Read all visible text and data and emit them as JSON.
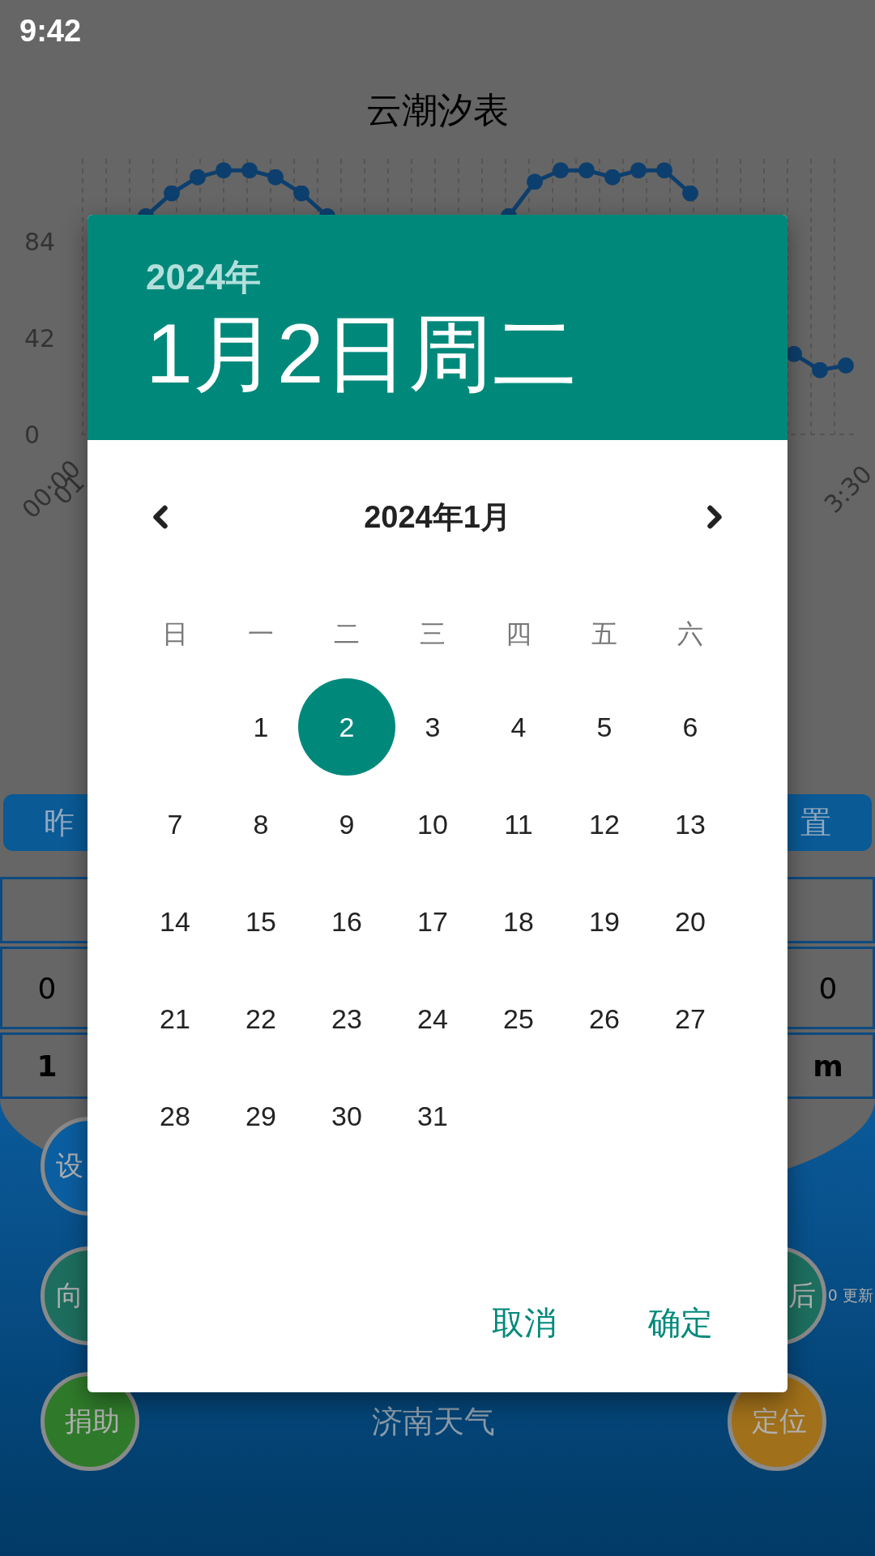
{
  "status_bar": {
    "time": "9:42"
  },
  "app": {
    "title": "云潮汐表",
    "chart": {
      "x_labels": [
        "00:00",
        "01",
        "3:30"
      ],
      "chart_data": {
        "type": "line",
        "ylim": [
          0,
          120
        ],
        "yticks": [
          84,
          42,
          0
        ],
        "grid": true,
        "series": [
          {
            "color": "#0d3f6e",
            "values": [
              null,
              null,
              95,
              105,
              112,
              115,
              115,
              112,
              105,
              95,
              null,
              null,
              null,
              null,
              null,
              null,
              95,
              110,
              115,
              115,
              112,
              115,
              115,
              105,
              null,
              null,
              null,
              35,
              28,
              30
            ]
          }
        ]
      }
    },
    "buttons": [
      "昨",
      "置"
    ],
    "table": {
      "rows": [
        [],
        [
          "0",
          "0"
        ],
        [
          "1",
          "m"
        ]
      ]
    },
    "circle_rows": [
      [
        {
          "label": "设",
          "color": "#0b5ea0"
        }
      ],
      [
        {
          "label": "向",
          "color": "#1d6e5e"
        },
        {
          "label": "后",
          "color": "#1d6e5e"
        }
      ],
      [
        {
          "label": "捐助",
          "color": "#2f7a2a"
        },
        {
          "label": "定位",
          "color": "#a0701a"
        }
      ]
    ],
    "update_note": "0 更新",
    "city": "济南天气"
  },
  "dialog": {
    "year": "2024年",
    "date": "1月2日周二",
    "month": "2024年1月",
    "weekdays": [
      "日",
      "一",
      "二",
      "三",
      "四",
      "五",
      "六"
    ],
    "weeks": [
      [
        {
          "kind": "empty"
        },
        {
          "kind": "day",
          "label": "1",
          "selected": false
        },
        {
          "kind": "day",
          "label": "2",
          "selected": true
        },
        {
          "kind": "day",
          "label": "3",
          "selected": false
        },
        {
          "kind": "day",
          "label": "4",
          "selected": false
        },
        {
          "kind": "day",
          "label": "5",
          "selected": false
        },
        {
          "kind": "day",
          "label": "6",
          "selected": false
        }
      ],
      [
        {
          "kind": "day",
          "label": "7",
          "selected": false
        },
        {
          "kind": "day",
          "label": "8",
          "selected": false
        },
        {
          "kind": "day",
          "label": "9",
          "selected": false
        },
        {
          "kind": "day",
          "label": "10",
          "selected": false
        },
        {
          "kind": "day",
          "label": "11",
          "selected": false
        },
        {
          "kind": "day",
          "label": "12",
          "selected": false
        },
        {
          "kind": "day",
          "label": "13",
          "selected": false
        }
      ],
      [
        {
          "kind": "day",
          "label": "14",
          "selected": false
        },
        {
          "kind": "day",
          "label": "15",
          "selected": false
        },
        {
          "kind": "day",
          "label": "16",
          "selected": false
        },
        {
          "kind": "day",
          "label": "17",
          "selected": false
        },
        {
          "kind": "day",
          "label": "18",
          "selected": false
        },
        {
          "kind": "day",
          "label": "19",
          "selected": false
        },
        {
          "kind": "day",
          "label": "20",
          "selected": false
        }
      ],
      [
        {
          "kind": "day",
          "label": "21",
          "selected": false
        },
        {
          "kind": "day",
          "label": "22",
          "selected": false
        },
        {
          "kind": "day",
          "label": "23",
          "selected": false
        },
        {
          "kind": "day",
          "label": "24",
          "selected": false
        },
        {
          "kind": "day",
          "label": "25",
          "selected": false
        },
        {
          "kind": "day",
          "label": "26",
          "selected": false
        },
        {
          "kind": "day",
          "label": "27",
          "selected": false
        }
      ],
      [
        {
          "kind": "day",
          "label": "28",
          "selected": false
        },
        {
          "kind": "day",
          "label": "29",
          "selected": false
        },
        {
          "kind": "day",
          "label": "30",
          "selected": false
        },
        {
          "kind": "day",
          "label": "31",
          "selected": false
        },
        {
          "kind": "empty"
        },
        {
          "kind": "empty"
        },
        {
          "kind": "empty"
        }
      ]
    ],
    "actions": [
      "取消",
      "确定"
    ]
  }
}
